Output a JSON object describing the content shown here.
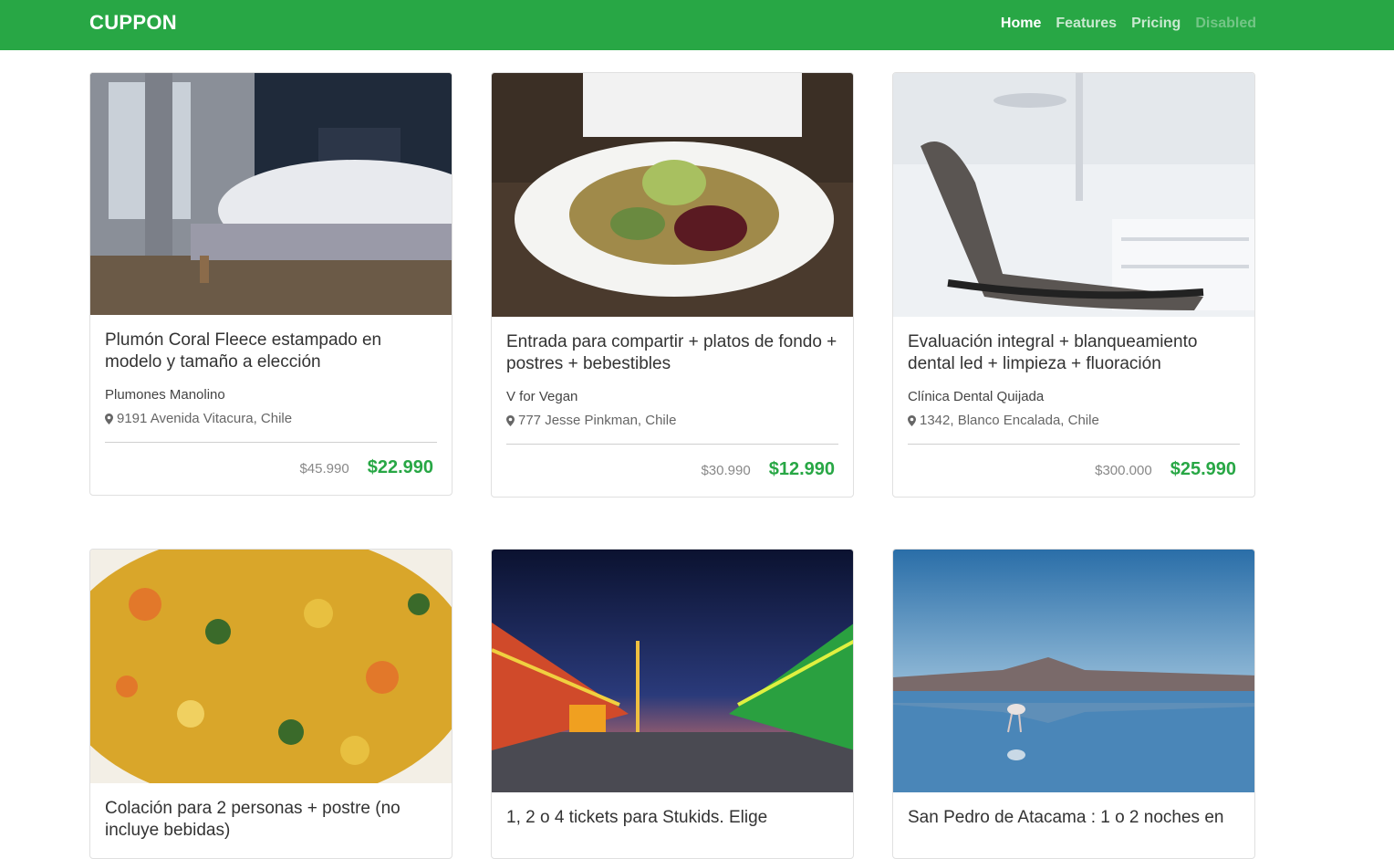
{
  "navbar": {
    "brand": "CUPPON",
    "links": [
      {
        "label": "Home"
      },
      {
        "label": "Features"
      },
      {
        "label": "Pricing"
      },
      {
        "label": "Disabled"
      }
    ]
  },
  "deals": [
    {
      "title": "Plumón Coral Fleece estampado en modelo y tamaño a elección",
      "merchant": "Plumones Manolino",
      "address": "9191 Avenida Vitacura, Chile",
      "old_price": "$45.990",
      "new_price": "$22.990",
      "image_icon": "bedroom-photo"
    },
    {
      "title": "Entrada para compartir + platos de fondo + postres + bebestibles",
      "merchant": "V for Vegan",
      "address": "777 Jesse Pinkman, Chile",
      "old_price": "$30.990",
      "new_price": "$12.990",
      "image_icon": "salad-plate-photo"
    },
    {
      "title": "Evaluación integral + blanqueamiento dental led + limpieza + fluoración",
      "merchant": "Clínica Dental Quijada",
      "address": "1342, Blanco Encalada, Chile",
      "old_price": "$300.000",
      "new_price": "$25.990",
      "image_icon": "dental-chair-photo"
    },
    {
      "title": "Colación para 2 personas + postre (no incluye bebidas)",
      "image_icon": "food-dish-photo"
    },
    {
      "title": "1, 2 o 4 tickets para Stukids. Elige",
      "image_icon": "fairground-photo"
    },
    {
      "title": "San Pedro de Atacama : 1 o 2 noches en",
      "image_icon": "flamingo-lake-photo"
    }
  ],
  "colors": {
    "brand_green": "#28a745"
  }
}
